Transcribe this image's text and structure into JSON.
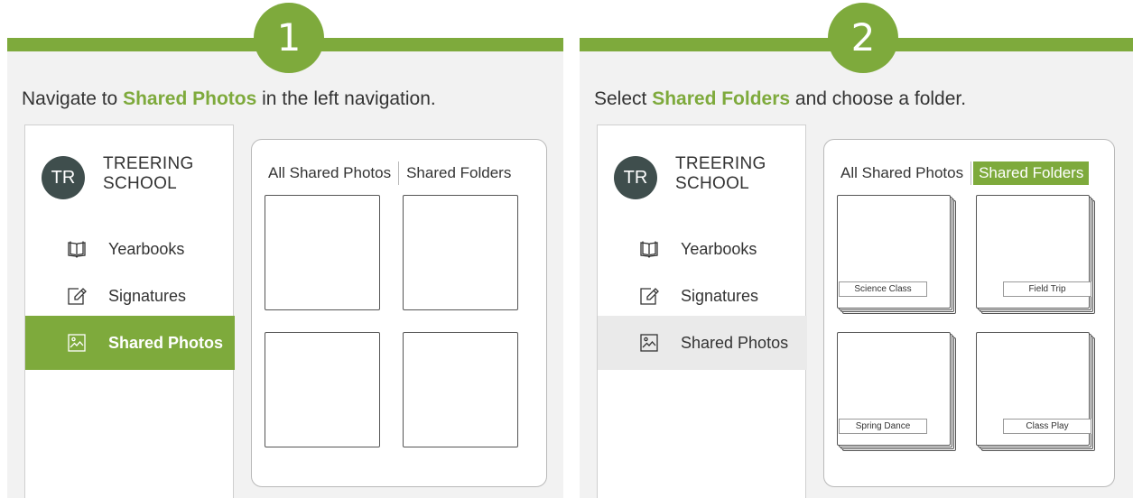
{
  "colors": {
    "accent": "#7eaa3c",
    "avatar_bg": "#3f4e4d",
    "panel_bg": "#f2f2f2"
  },
  "steps": [
    {
      "number": "1",
      "instruction": {
        "prefix": "Navigate to ",
        "highlight": "Shared Photos",
        "suffix": " in the left navigation."
      },
      "nav": {
        "avatar": "TR",
        "school_line1": "TREERING",
        "school_line2": "SCHOOL",
        "items": [
          {
            "label": "Yearbooks",
            "icon": "book-icon"
          },
          {
            "label": "Signatures",
            "icon": "pen-icon"
          },
          {
            "label": "Shared Photos",
            "icon": "image-icon",
            "state": "active"
          }
        ]
      },
      "tabs": [
        {
          "label": "All Shared Photos"
        },
        {
          "label": "Shared Folders"
        }
      ]
    },
    {
      "number": "2",
      "instruction": {
        "prefix": "Select ",
        "highlight": "Shared Folders",
        "suffix": " and choose a folder."
      },
      "nav": {
        "avatar": "TR",
        "school_line1": "TREERING",
        "school_line2": "SCHOOL",
        "items": [
          {
            "label": "Yearbooks",
            "icon": "book-icon"
          },
          {
            "label": "Signatures",
            "icon": "pen-icon"
          },
          {
            "label": "Shared Photos",
            "icon": "image-icon",
            "state": "hover"
          }
        ]
      },
      "tabs": [
        {
          "label": "All Shared Photos"
        },
        {
          "label": "Shared Folders",
          "state": "selected"
        }
      ],
      "folders": [
        {
          "label": "Science Class"
        },
        {
          "label": "Field Trip"
        },
        {
          "label": "Spring Dance"
        },
        {
          "label": "Class Play"
        }
      ]
    }
  ]
}
